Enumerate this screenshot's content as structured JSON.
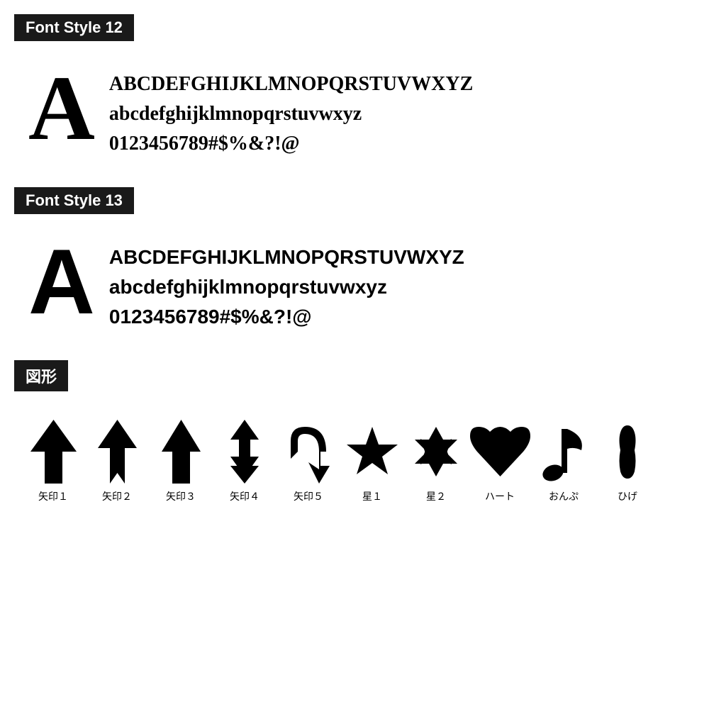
{
  "sections": [
    {
      "id": "font12",
      "label": "Font Style 12",
      "bigLetter": "A",
      "uppercase": "ABCDEFGHIJKLMNOPQRSTUVWXYZ",
      "lowercase": "abcdefghijklmnopqrstuvwxyz",
      "numbers": "0123456789#$%&?!@",
      "fontClass": "font12"
    },
    {
      "id": "font13",
      "label": "Font Style 13",
      "bigLetter": "A",
      "uppercase": "ABCDEFGHIJKLMNOPQRSTUVWXYZ",
      "lowercase": "abcdefghijklmnopqrstuvwxyz",
      "numbers": "0123456789#$%&?!@",
      "fontClass": "font13"
    }
  ],
  "shapesSection": {
    "label": "図形",
    "shapes": [
      {
        "id": "yajirushi1",
        "label": "矢印１"
      },
      {
        "id": "yajirushi2",
        "label": "矢印２"
      },
      {
        "id": "yajirushi3",
        "label": "矢印３"
      },
      {
        "id": "yajirushi4",
        "label": "矢印４"
      },
      {
        "id": "yajirushi5",
        "label": "矢印５"
      },
      {
        "id": "hoshi1",
        "label": "星１"
      },
      {
        "id": "hoshi2",
        "label": "星２"
      },
      {
        "id": "heart",
        "label": "ハート"
      },
      {
        "id": "onpu",
        "label": "おんぷ"
      },
      {
        "id": "hige",
        "label": "ひげ"
      }
    ]
  }
}
